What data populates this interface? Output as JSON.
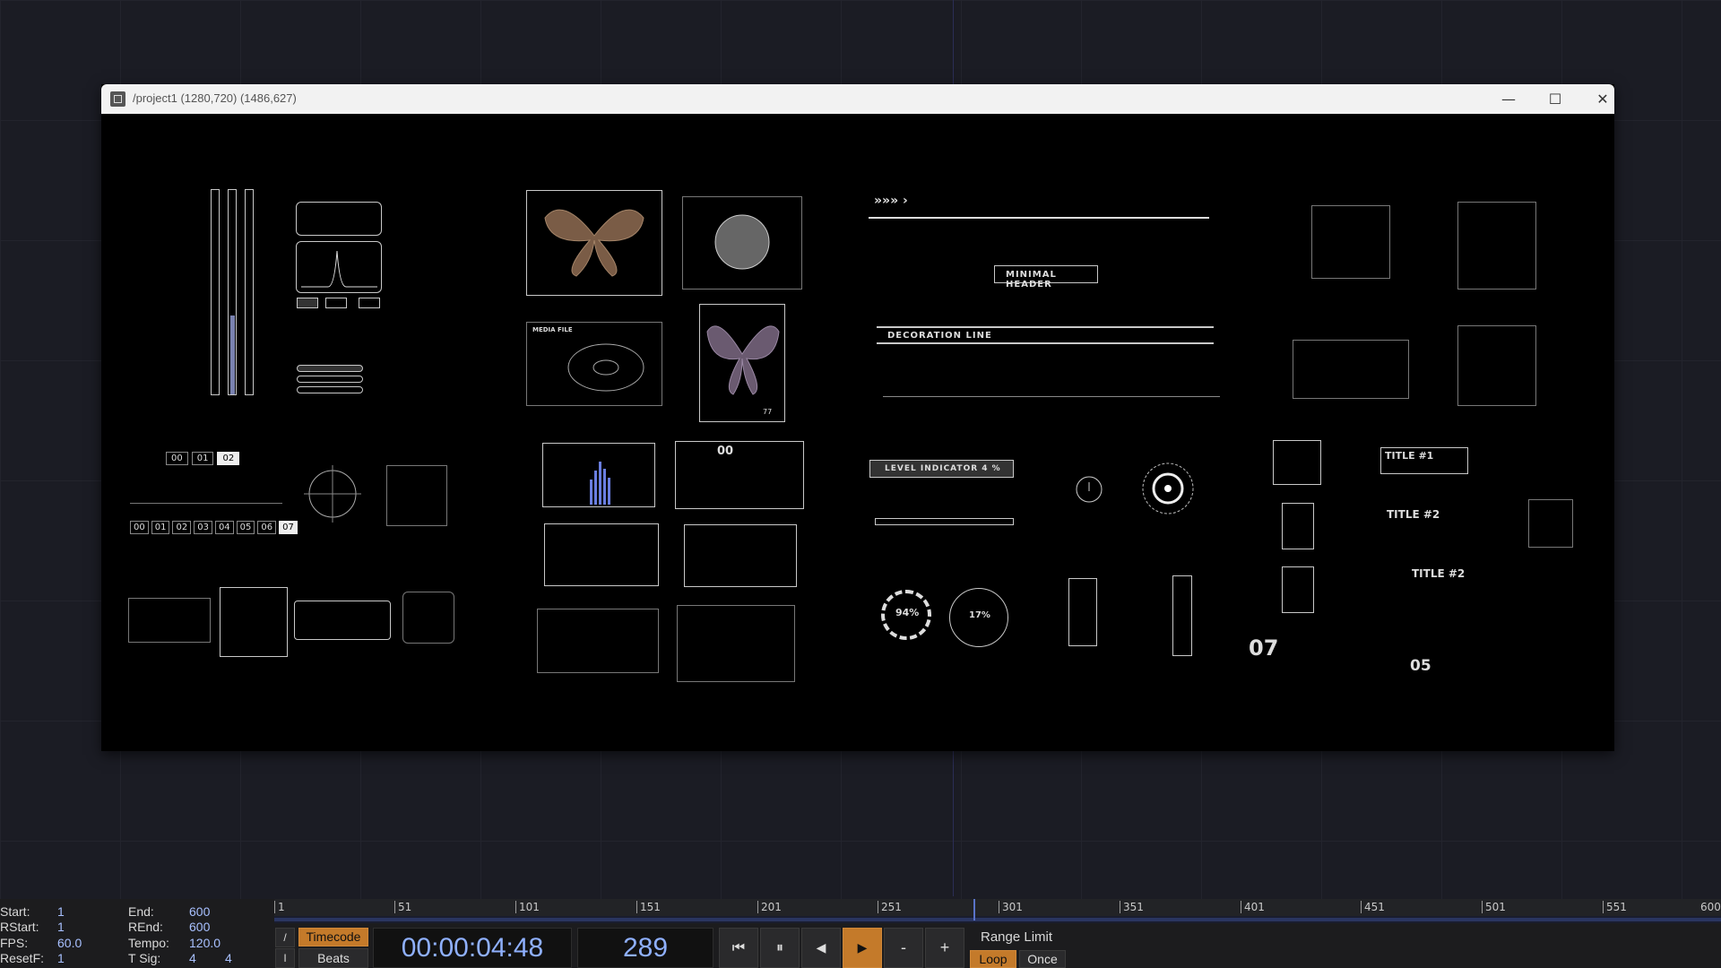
{
  "window": {
    "title": "/project1 (1280,720) (1486,627)",
    "minimize_glyph": "—",
    "maximize_glyph": "☐",
    "close_glyph": "✕"
  },
  "viewer": {
    "minimal_header": "MINIMAL HEADER",
    "decoration_line": "DECORATION LINE",
    "level_indicator": "LEVEL INDICATOR  4 %",
    "arrows": "»»» ›",
    "media_file_1": "MEDIA FILE",
    "counter_top": [
      "00",
      "01",
      "02"
    ],
    "counter_bottom": [
      "00",
      "01",
      "02",
      "03",
      "04",
      "05",
      "06",
      "07"
    ],
    "small_00": "00",
    "ring_94": "94%",
    "ring_17": "17%",
    "title1": "TITLE #1",
    "title2a": "TITLE #2",
    "title2b": "TITLE #2",
    "num07": "07",
    "num05": "05",
    "num_77": "77"
  },
  "timeline": {
    "ticks": [
      "1",
      "51",
      "101",
      "151",
      "201",
      "251",
      "301",
      "351",
      "401",
      "451",
      "501",
      "551",
      "600"
    ],
    "playhead_frame": 289
  },
  "info": {
    "start_label": "Start:",
    "start": "1",
    "rstart_label": "RStart:",
    "rstart": "1",
    "fps_label": "FPS:",
    "fps": "60.0",
    "resetf_label": "ResetF:",
    "resetf": "1",
    "end_label": "End:",
    "end": "600",
    "rend_label": "REnd:",
    "rend": "600",
    "tempo_label": "Tempo:",
    "tempo": "120.0",
    "tsig_label": "T Sig:",
    "tsig_a": "4",
    "tsig_b": "4"
  },
  "transport": {
    "timecode_mode": "Timecode",
    "beats_mode": "Beats",
    "timecode": "00:00:04:48",
    "frame": "289",
    "btn_start": "⏮",
    "btn_pause": "⏸",
    "btn_back": "◀",
    "btn_play": "▶",
    "btn_minus": "-",
    "btn_plus": "+",
    "range_limit": "Range Limit",
    "loop": "Loop",
    "once": "Once",
    "side_a": "/",
    "side_b": "I"
  },
  "colors": {
    "accent_orange": "#c47a2a",
    "value_blue": "#8fb0ff",
    "playhead": "#5a73c8"
  }
}
